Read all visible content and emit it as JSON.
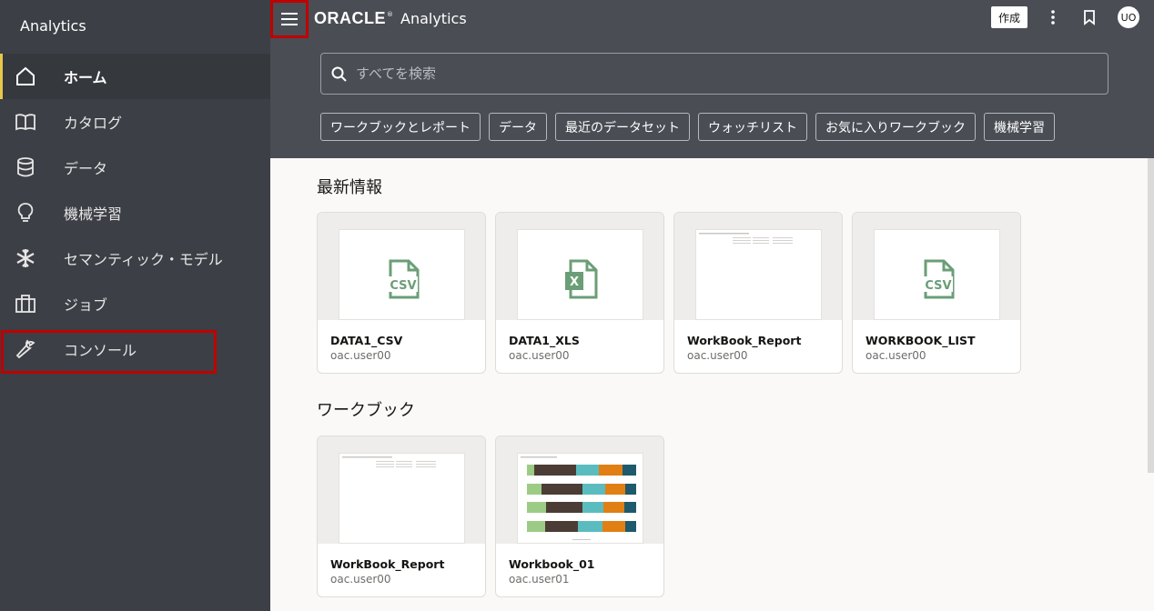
{
  "sidebar": {
    "title": "Analytics",
    "items": [
      {
        "label": "ホーム",
        "icon": "home-icon",
        "active": true
      },
      {
        "label": "カタログ",
        "icon": "book-icon"
      },
      {
        "label": "データ",
        "icon": "database-icon"
      },
      {
        "label": "機械学習",
        "icon": "lightbulb-icon"
      },
      {
        "label": "セマンティック・モデル",
        "icon": "snowflake-icon"
      },
      {
        "label": "ジョブ",
        "icon": "briefcase-icon"
      },
      {
        "label": "コンソール",
        "icon": "wrench-icon"
      }
    ]
  },
  "header": {
    "brand_oracle": "ORACLE",
    "brand_reg": "®",
    "brand_analytics": "Analytics",
    "create_label": "作成",
    "avatar_initials": "UO",
    "search_placeholder": "すべてを検索",
    "chips": [
      "ワークブックとレポート",
      "データ",
      "最近のデータセット",
      "ウォッチリスト",
      "お気に入りワークブック",
      "機械学習"
    ]
  },
  "colors": {
    "sidebar_bg": "#3c3f45",
    "header_bg": "#4a4d54",
    "active_accent": "#e8c74b",
    "highlight_red": "#c00000",
    "file_icon_green": "#6b9e77"
  },
  "sections": {
    "recent": {
      "title": "最新情報",
      "cards": [
        {
          "name": "DATA1_CSV",
          "owner": "oac.user00",
          "thumb": "csv-file-icon",
          "icon_text": "CSV"
        },
        {
          "name": "DATA1_XLS",
          "owner": "oac.user00",
          "thumb": "xls-file-icon",
          "icon_text": "X"
        },
        {
          "name": "WorkBook_Report",
          "owner": "oac.user00",
          "thumb": "report-preview"
        },
        {
          "name": "WORKBOOK_LIST",
          "owner": "oac.user00",
          "thumb": "csv-file-icon",
          "icon_text": "CSV"
        }
      ]
    },
    "workbooks": {
      "title": "ワークブック",
      "cards": [
        {
          "name": "WorkBook_Report",
          "owner": "oac.user00",
          "thumb": "report-preview"
        },
        {
          "name": "Workbook_01",
          "owner": "oac.user01",
          "thumb": "bar-chart-preview"
        }
      ]
    }
  }
}
